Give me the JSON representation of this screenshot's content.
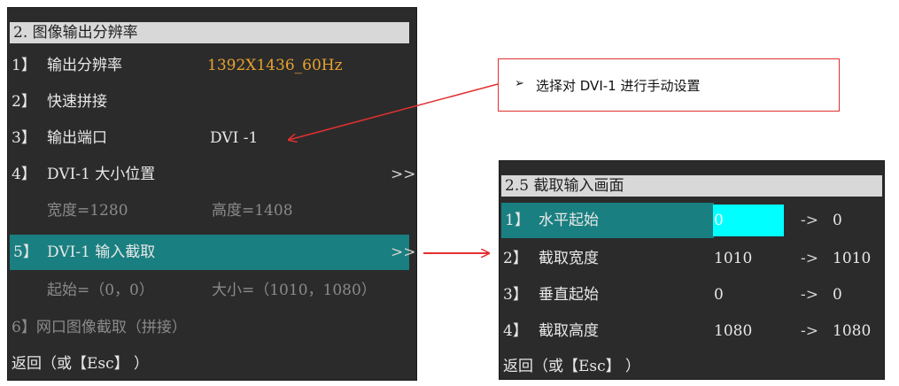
{
  "left_menu": {
    "title": "2. 图像输出分辨率",
    "items": [
      {
        "num": "1】",
        "label": "输出分辨率",
        "value": "1392X1436_60Hz"
      },
      {
        "num": "2】",
        "label": "快速拼接"
      },
      {
        "num": "3】",
        "label": "输出端口",
        "value": "DVI -1"
      },
      {
        "num": "4】",
        "label": "DVI-1 大小位置",
        "arrow": ">>"
      },
      {
        "sub1": "宽度=1280",
        "sub2": "高度=1408"
      },
      {
        "num": "5】",
        "label": "DVI-1 输入截取",
        "arrow": ">>"
      },
      {
        "sub1": "起始=（0，0）",
        "sub2": "大小=（1010，1080）"
      },
      {
        "label": "6】网口图像截取（拼接）"
      },
      {
        "label": "返回（或【Esc】 ）"
      }
    ]
  },
  "right_menu": {
    "title": "2.5 截取输入画面",
    "items": [
      {
        "num": "1】",
        "label": "水平起始",
        "value": "0",
        "arrow": "->",
        "target": "0"
      },
      {
        "num": "2】",
        "label": "截取宽度",
        "value": "1010",
        "arrow": "->",
        "target": "1010"
      },
      {
        "num": "3】",
        "label": "垂直起始",
        "value": "0",
        "arrow": "->",
        "target": "0"
      },
      {
        "num": "4】",
        "label": "截取高度",
        "value": "1080",
        "arrow": "->",
        "target": "1080"
      },
      {
        "label": "返回（或【Esc】 ）"
      }
    ]
  },
  "callout": {
    "bullet": "➢",
    "text": "选择对  DVI-1  进行手动设置"
  },
  "colors": {
    "panel_bg": "#2b2b2b",
    "title_bg": "#d8d8d8",
    "selected_bg": "#1a7f80",
    "highlight_value": "#e8a230",
    "cursor_box": "#00ffff",
    "annotation_red": "#e23030"
  }
}
